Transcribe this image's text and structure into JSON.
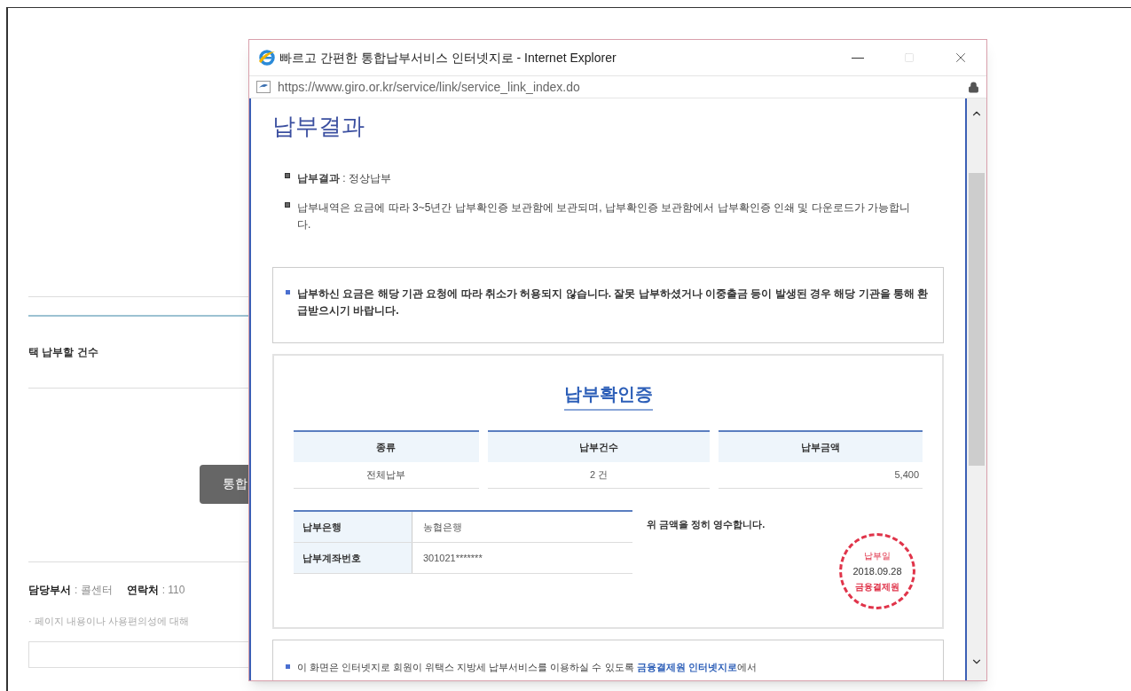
{
  "background_page": {
    "section_label": "택 납부할 건수",
    "button": "통합",
    "department_label": "담당부서",
    "department": ": 콜센터",
    "contact_label": "연락처",
    "contact": ": 110",
    "feedback_note": "· 페이지 내용이나 사용편의성에 대해"
  },
  "window": {
    "title": "빠르고 간편한 통합납부서비스 인터넷지로 - Internet Explorer",
    "url": "https://www.giro.or.kr/service/link/service_link_index.do",
    "maximize_disabled": true
  },
  "page": {
    "heading": "납부결과",
    "info": [
      "**납부결과** : 정상납부",
      "납부내역은 요금에 따라 3~5년간 납부확인증 보관함에 보관되며, 납부확인증 보관함에서 납부확인증 인쇄 및 다운로드가 가능합니다."
    ],
    "notice": "납부하신 요금은 해당 기관 요청에 따라 취소가 허용되지 않습니다. 잘못 납부하셨거나 이중출금 등이 발생된 경우 해당 기관을 통해 환급받으시기 바랍니다.",
    "certificate": {
      "title": "납부확인증",
      "columns": [
        "종류",
        "납부건수",
        "납부금액"
      ],
      "rows": [
        [
          "전체납부",
          "2 건",
          "5,400"
        ]
      ],
      "bank_rows": [
        {
          "label": "납부은행",
          "value": "농협은행"
        },
        {
          "label": "납부계좌번호",
          "value": "301021*******"
        }
      ],
      "receipt": "위 금액을 정히 영수합니다.",
      "stamp": {
        "label": "납부일",
        "date": "2018.09.28",
        "issuer": "금융결제원"
      }
    },
    "footer_note": {
      "text": "이 화면은 인터넷지로 회원이 위택스 지방세 납부서비스를 이용하실 수 있도록 ",
      "link": "금융결제원 인터넷지로",
      "text_after": "에서"
    }
  }
}
